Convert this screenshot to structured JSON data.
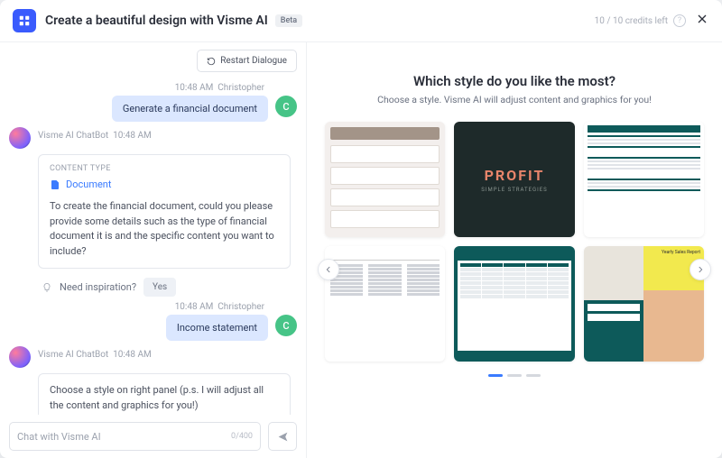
{
  "header": {
    "title": "Create a beautiful design with Visme AI",
    "badge": "Beta",
    "credits": "10 / 10 credits left"
  },
  "toolbar": {
    "restart": "Restart Dialogue"
  },
  "chat": {
    "user_initial": "C",
    "msg1": {
      "time": "10:48 AM",
      "name": "Christopher",
      "text": "Generate a financial document"
    },
    "bot1": {
      "time": "10:48 AM",
      "name": "Visme AI ChatBot",
      "content_type_label": "CONTENT TYPE",
      "content_type": "Document",
      "text": "To create the financial document, could you please provide some details such as the type of financial document it is and the specific content you want to include?"
    },
    "inspire": {
      "label": "Need inspiration?",
      "yes": "Yes"
    },
    "msg2": {
      "time": "10:48 AM",
      "name": "Christopher",
      "text": "Income statement"
    },
    "bot2": {
      "time": "10:48 AM",
      "name": "Visme AI ChatBot",
      "text": "Choose a style on right panel (p.s. I will adjust all the content and graphics for you!)"
    }
  },
  "input": {
    "placeholder": "Chat with Visme AI",
    "counter": "0/400"
  },
  "right": {
    "title": "Which style do you like the most?",
    "subtitle": "Choose a style. Visme AI will adjust content and graphics for you!",
    "t2_title": "PROFIT",
    "t2_sub": "SIMPLE STRATEGIES",
    "t6_title": "Yearly Sales Report"
  }
}
